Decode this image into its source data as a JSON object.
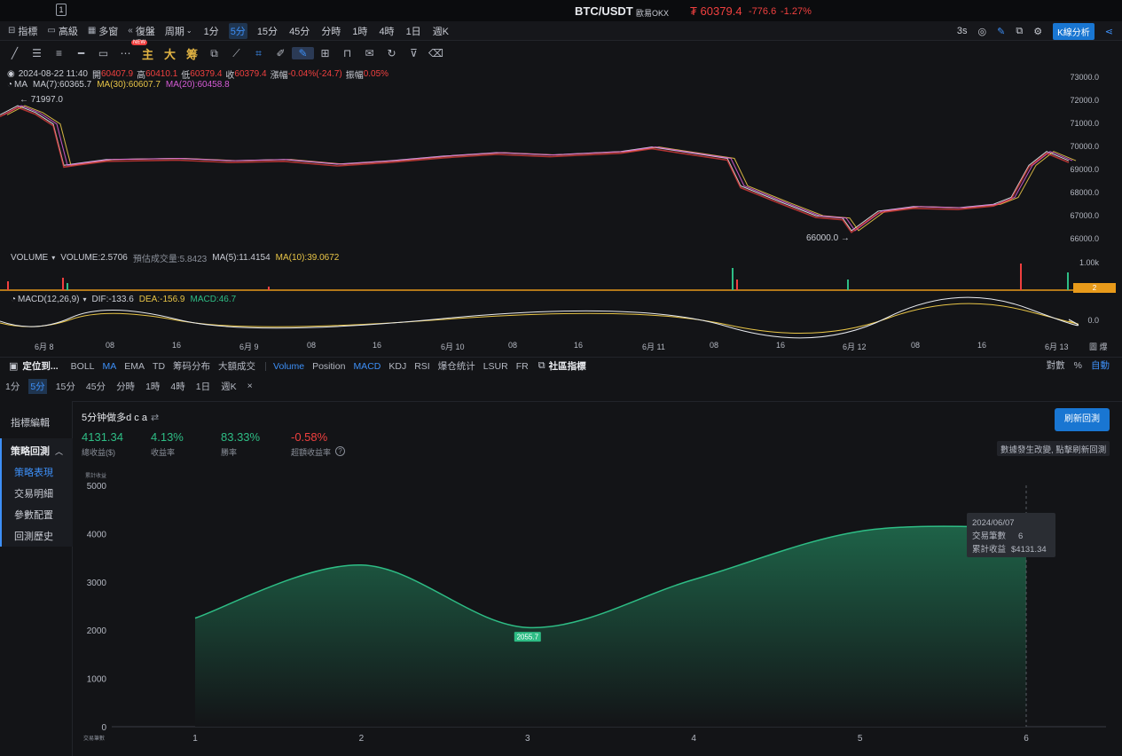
{
  "topbar": {
    "window_icon": "1",
    "pair": "BTC/USDT",
    "exchange": "歐易OKX",
    "price": "₮ 60379.4",
    "change": "-776.6",
    "change_pct": "-1.27%"
  },
  "toolbar": {
    "indicators": "指標",
    "advanced": "高級",
    "multi_window": "多窗",
    "replay": "復盤",
    "period": "周期",
    "periods": [
      "1分",
      "5分",
      "15分",
      "45分",
      "分時",
      "1時",
      "4時",
      "1日",
      "週K"
    ],
    "active_period": "5分",
    "refresh_rate": "3s",
    "kline_analysis": "K線分析"
  },
  "draw_tools": {
    "new_badge": "NEW",
    "main_label": "主",
    "big_label": "大",
    "chip_label": "筹"
  },
  "main_chart": {
    "date_line": {
      "date": "2024-08-22 11:40",
      "open_label": "開",
      "open": "60407.9",
      "high_label": "高",
      "high": "60410.1",
      "low_label": "低",
      "low": "60379.4",
      "close_label": "收",
      "close": "60379.4",
      "change_label": "漲幅",
      "change": "-0.04%(-24.7)",
      "amp_label": "振幅",
      "amp": "0.05%"
    },
    "ma_line": {
      "name": "MA",
      "ma7": "MA(7):60365.7",
      "ma30": "MA(30):60607.7",
      "ma20": "MA(20):60458.8"
    },
    "high_marker": "← 71997.0",
    "low_marker": "66000.0 →",
    "y_ticks": [
      "73000.0",
      "72000.0",
      "71000.0",
      "70000.0",
      "69000.0",
      "68000.0",
      "67000.0",
      "66000.0"
    ],
    "colors": {
      "ma7": "#e8eaee",
      "ma30": "#e8c547",
      "ma20": "#d65bd6",
      "up": "#2ebd85",
      "down": "#f0403f"
    }
  },
  "volume": {
    "label": "VOLUME",
    "vol": "VOLUME:2.5706",
    "est": "預估成交量:5.8423",
    "ma5": "MA(5):11.4154",
    "ma10": "MA(10):39.0672",
    "y_tick": "1.00k",
    "badge": "2"
  },
  "macd": {
    "label": "MACD(12,26,9)",
    "dif": "DIF:-133.6",
    "dea": "DEA:-156.9",
    "macd": "MACD:46.7",
    "y_tick": "0.0"
  },
  "x_axis": [
    "6月 8",
    "08",
    "16",
    "6月 9",
    "08",
    "16",
    "6月 10",
    "08",
    "16",
    "6月 11",
    "08",
    "16",
    "6月 12",
    "08",
    "16",
    "6月 13"
  ],
  "x_axis_right": "圖 爆",
  "indicator_row": {
    "locate": "定位到...",
    "tabs": [
      "BOLL",
      "MA",
      "EMA",
      "TD",
      "筹码分布",
      "大額成交"
    ],
    "active_main": "MA",
    "tabs2": [
      "Volume",
      "Position",
      "MACD",
      "KDJ",
      "RSI",
      "爆仓统计",
      "LSUR",
      "FR"
    ],
    "active_sub": [
      "Volume",
      "MACD"
    ],
    "community": "社區指標",
    "log": "對數",
    "percent": "%",
    "auto": "自動"
  },
  "period_row2": {
    "items": [
      "1分",
      "5分",
      "15分",
      "45分",
      "分時",
      "1時",
      "4時",
      "1日",
      "週K"
    ],
    "active": "5分",
    "close": "×"
  },
  "side_nav": {
    "editor": "指標編輯",
    "backtest": "策略回測",
    "items": [
      "策略表現",
      "交易明細",
      "參數配置",
      "回測歷史"
    ],
    "active": "策略表現"
  },
  "strategy": {
    "name": "5分钟做多d c a",
    "metrics": [
      {
        "value": "4131.34",
        "label": "總收益($)",
        "color": "#2ebd85"
      },
      {
        "value": "4.13%",
        "label": "收益率",
        "color": "#2ebd85"
      },
      {
        "value": "83.33%",
        "label": "勝率",
        "color": "#2ebd85"
      },
      {
        "value": "-0.58%",
        "label": "超額收益率",
        "color": "#f0403f"
      }
    ],
    "refresh_button": "刷新回測",
    "notice": "數據發生改變, 點擊刷新回測"
  },
  "chart_data": {
    "type": "area",
    "ylabel": "累計收益",
    "xlabel": "交易筆數",
    "x": [
      1,
      2,
      3,
      4,
      5,
      6
    ],
    "values": [
      2250,
      3350,
      2055.7,
      3050,
      4050,
      4131.34
    ],
    "ylim": [
      0,
      5000
    ],
    "y_ticks": [
      0,
      1000,
      2000,
      3000,
      4000,
      5000
    ],
    "data_label": "2055.7",
    "tooltip": {
      "date": "2024/06/07",
      "trades_label": "交易筆數",
      "trades": "6",
      "profit_label": "累計收益",
      "profit": "$4131.34"
    },
    "color": "#2ebd85"
  }
}
